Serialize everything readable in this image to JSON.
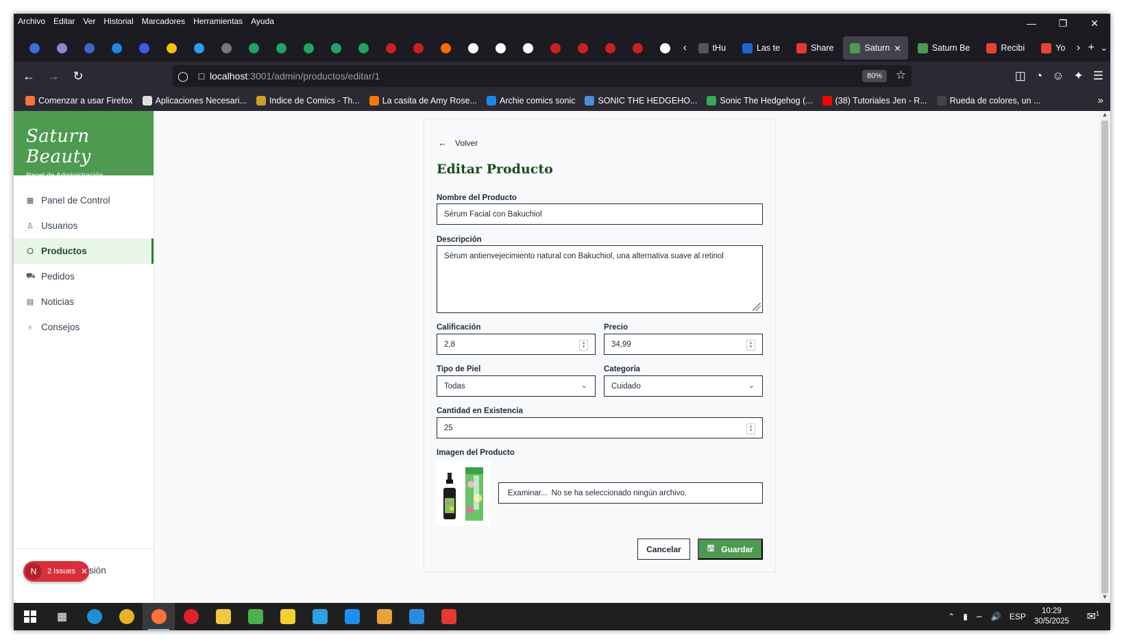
{
  "browser": {
    "menu": [
      "Archivo",
      "Editar",
      "Ver",
      "Historial",
      "Marcadores",
      "Herramientas",
      "Ayuda"
    ],
    "pinned_tab_colors": [
      "#3b6fd8",
      "#8f86c9",
      "#3f63c7",
      "#1e88e5",
      "#3d5af1",
      "#f2c200",
      "#2a9df4",
      "#777777",
      "#1fa463",
      "#1fa463",
      "#1fa463",
      "#1fa463",
      "#1fa463",
      "#cc1f1f",
      "#cc1f1f",
      "#ff6a00",
      "#ffffff",
      "#ffffff",
      "#ffffff",
      "#cc1f1f",
      "#cc1f1f",
      "#cc1f1f",
      "#cc1f1f",
      "#ffffff"
    ],
    "tabs": [
      {
        "label": "tHu",
        "color": "#555555"
      },
      {
        "label": "Las te",
        "color": "#1f66d1"
      },
      {
        "label": "Share",
        "color": "#e53935"
      },
      {
        "label": "Saturn",
        "color": "#4e9a51",
        "active": true
      },
      {
        "label": "Saturn Be",
        "color": "#4e9a51"
      },
      {
        "label": "Recibi",
        "color": "#ea4335"
      },
      {
        "label": "Yo",
        "color": "#ea4335"
      }
    ],
    "url_host": "localhost",
    "url_path": ":3001/admin/productos/editar/1",
    "zoom": "80%",
    "bookmarks": [
      {
        "label": "Comenzar a usar Firefox",
        "color": "#ff7139"
      },
      {
        "label": "Aplicaciones Necesari...",
        "color": "#dddddd"
      },
      {
        "label": "Indice de Comics - Th...",
        "color": "#c9a227"
      },
      {
        "label": "La casita de Amy Rose...",
        "color": "#f57c00"
      },
      {
        "label": "Archie comics sonic",
        "color": "#1e88e5"
      },
      {
        "label": "SONIC THE HEDGEHO...",
        "color": "#4a90d9"
      },
      {
        "label": "Sonic The Hedgehog (...",
        "color": "#34a853"
      },
      {
        "label": "(38) Tutoriales Jen - R...",
        "color": "#ff0000"
      },
      {
        "label": "Rueda de colores, un ...",
        "color": "#444444"
      }
    ]
  },
  "sidebar": {
    "brand_title": "Saturn Beauty",
    "brand_subtitle": "Panel de Administración",
    "items": [
      {
        "label": "Panel de Control",
        "icon": "grid-icon",
        "glyph": "▦"
      },
      {
        "label": "Usuarios",
        "icon": "users-icon",
        "glyph": "♙"
      },
      {
        "label": "Productos",
        "icon": "box-icon",
        "glyph": "⬡",
        "active": true
      },
      {
        "label": "Pedidos",
        "icon": "cart-icon",
        "glyph": "⛟"
      },
      {
        "label": "Noticias",
        "icon": "newspaper-icon",
        "glyph": "▤"
      },
      {
        "label": "Consejos",
        "icon": "lightbulb-icon",
        "glyph": "♁"
      }
    ],
    "logout_partial": "sión",
    "issues_badge": {
      "letter": "N",
      "label": "2 Issues"
    }
  },
  "form": {
    "back_label": "Volver",
    "title": "Editar Producto",
    "name_label": "Nombre del Producto",
    "name_value": "Sérum Facial con Bakuchiol",
    "description_label": "Descripción",
    "description_value": "Sérum antienvejecimiento natural con Bakuchiol, una alternativa suave al retinol",
    "rating_label": "Calificación",
    "rating_value": "2,8",
    "price_label": "Precio",
    "price_value": "34,99",
    "skin_type_label": "Tipo de Piel",
    "skin_type_value": "Todas",
    "category_label": "Categoría",
    "category_value": "Cuidado",
    "stock_label": "Cantidad en Existencia",
    "stock_value": "25",
    "image_label": "Imagen del Producto",
    "browse_label": "Examinar...",
    "no_file_text": "No se ha seleccionado ningún archivo.",
    "cancel_label": "Cancelar",
    "save_label": "Guardar"
  },
  "taskbar": {
    "apps": [
      {
        "name": "edge",
        "color": "#1f8fd6"
      },
      {
        "name": "chrome",
        "color": "#e9b325"
      },
      {
        "name": "firefox",
        "color": "#ff7139",
        "active": true
      },
      {
        "name": "opera",
        "color": "#e0202b"
      },
      {
        "name": "file-explorer",
        "color": "#f4c542"
      },
      {
        "name": "xbox",
        "color": "#4caf50"
      },
      {
        "name": "player",
        "color": "#f2d12e"
      },
      {
        "name": "telegram",
        "color": "#2aa3df"
      },
      {
        "name": "app-blue",
        "color": "#1d8ff0"
      },
      {
        "name": "paint",
        "color": "#e9a23b"
      },
      {
        "name": "vscode",
        "color": "#2b8be0"
      },
      {
        "name": "pocket",
        "color": "#e53935"
      }
    ],
    "lang": "ESP",
    "time": "10:29",
    "date": "30/5/2025",
    "notifications": "1"
  }
}
